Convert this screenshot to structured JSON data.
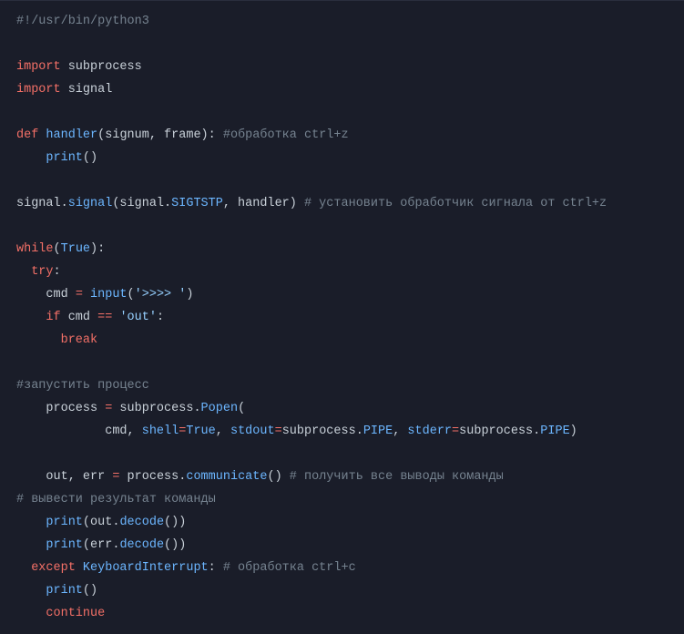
{
  "code": {
    "tokens": [
      [
        [
          "comment",
          "#!/usr/bin/python3"
        ]
      ],
      [],
      [
        [
          "kw",
          "import"
        ],
        [
          "plain",
          " subprocess"
        ]
      ],
      [
        [
          "kw",
          "import"
        ],
        [
          "plain",
          " signal"
        ]
      ],
      [],
      [
        [
          "kw",
          "def"
        ],
        [
          "plain",
          " "
        ],
        [
          "func",
          "handler"
        ],
        [
          "plain",
          "(signum, frame): "
        ],
        [
          "comment",
          "#обработка ctrl+z"
        ]
      ],
      [
        [
          "plain",
          "    "
        ],
        [
          "func",
          "print"
        ],
        [
          "plain",
          "()"
        ]
      ],
      [],
      [
        [
          "plain",
          "signal."
        ],
        [
          "func",
          "signal"
        ],
        [
          "plain",
          "(signal."
        ],
        [
          "const",
          "SIGTSTP"
        ],
        [
          "plain",
          ", handler) "
        ],
        [
          "comment",
          "# установить обработчик сигнала от ctrl+z"
        ]
      ],
      [],
      [
        [
          "kw",
          "while"
        ],
        [
          "plain",
          "("
        ],
        [
          "const",
          "True"
        ],
        [
          "plain",
          "):"
        ]
      ],
      [
        [
          "plain",
          "  "
        ],
        [
          "kw",
          "try"
        ],
        [
          "plain",
          ":"
        ]
      ],
      [
        [
          "plain",
          "    cmd "
        ],
        [
          "kw",
          "="
        ],
        [
          "plain",
          " "
        ],
        [
          "func",
          "input"
        ],
        [
          "plain",
          "("
        ],
        [
          "str",
          "'>>>> '"
        ],
        [
          "plain",
          ")"
        ]
      ],
      [
        [
          "plain",
          "    "
        ],
        [
          "kw",
          "if"
        ],
        [
          "plain",
          " cmd "
        ],
        [
          "kw",
          "=="
        ],
        [
          "plain",
          " "
        ],
        [
          "str",
          "'out'"
        ],
        [
          "plain",
          ":"
        ]
      ],
      [
        [
          "plain",
          "      "
        ],
        [
          "kw",
          "break"
        ]
      ],
      [],
      [
        [
          "comment",
          "#запустить процесс"
        ]
      ],
      [
        [
          "plain",
          "    process "
        ],
        [
          "kw",
          "="
        ],
        [
          "plain",
          " subprocess."
        ],
        [
          "func",
          "Popen"
        ],
        [
          "plain",
          "("
        ]
      ],
      [
        [
          "plain",
          "            cmd, "
        ],
        [
          "const",
          "shell"
        ],
        [
          "kw",
          "="
        ],
        [
          "const",
          "True"
        ],
        [
          "plain",
          ", "
        ],
        [
          "const",
          "stdout"
        ],
        [
          "kw",
          "="
        ],
        [
          "plain",
          "subprocess."
        ],
        [
          "const",
          "PIPE"
        ],
        [
          "plain",
          ", "
        ],
        [
          "const",
          "stderr"
        ],
        [
          "kw",
          "="
        ],
        [
          "plain",
          "subprocess."
        ],
        [
          "const",
          "PIPE"
        ],
        [
          "plain",
          ")"
        ]
      ],
      [],
      [
        [
          "plain",
          "    out, err "
        ],
        [
          "kw",
          "="
        ],
        [
          "plain",
          " process."
        ],
        [
          "func",
          "communicate"
        ],
        [
          "plain",
          "() "
        ],
        [
          "comment",
          "# получить все выводы команды"
        ]
      ],
      [
        [
          "comment",
          "# вывести результат команды"
        ]
      ],
      [
        [
          "plain",
          "    "
        ],
        [
          "func",
          "print"
        ],
        [
          "plain",
          "(out."
        ],
        [
          "func",
          "decode"
        ],
        [
          "plain",
          "())"
        ]
      ],
      [
        [
          "plain",
          "    "
        ],
        [
          "func",
          "print"
        ],
        [
          "plain",
          "(err."
        ],
        [
          "func",
          "decode"
        ],
        [
          "plain",
          "())"
        ]
      ],
      [
        [
          "plain",
          "  "
        ],
        [
          "kw",
          "except"
        ],
        [
          "plain",
          " "
        ],
        [
          "const",
          "KeyboardInterrupt"
        ],
        [
          "plain",
          ": "
        ],
        [
          "comment",
          "# обработка ctrl+c"
        ]
      ],
      [
        [
          "plain",
          "    "
        ],
        [
          "func",
          "print"
        ],
        [
          "plain",
          "()"
        ]
      ],
      [
        [
          "plain",
          "    "
        ],
        [
          "kw",
          "continue"
        ]
      ]
    ]
  }
}
